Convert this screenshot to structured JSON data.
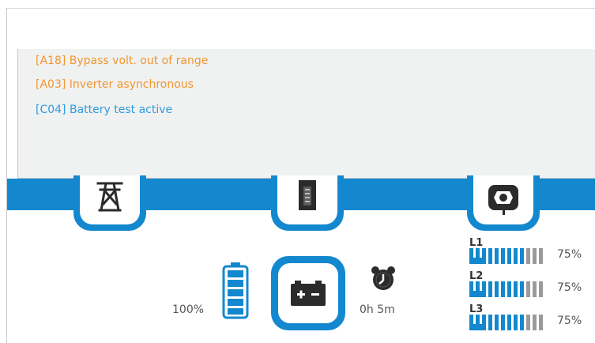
{
  "alarms": [
    {
      "code": "[A18]",
      "text": "Bypass volt. out of range",
      "color": "#f0962f"
    },
    {
      "code": "[A03]",
      "text": "Inverter asynchronous",
      "color": "#f0962f"
    },
    {
      "code": "[C04]",
      "text": "Battery test active",
      "color": "#2f9be0"
    }
  ],
  "colors": {
    "accent": "#1488cf",
    "warning": "#f0962f",
    "info": "#2f9be0"
  },
  "icons": {
    "bypass": "power-tower-icon",
    "inverter": "inverter-icon",
    "output": "power-socket-icon",
    "battery": "battery-icon",
    "battery_level": "battery-level-icon",
    "timer": "alarm-clock-icon"
  },
  "battery": {
    "charge": "100%",
    "charge_value": 1.0,
    "runtime": "0h 5m"
  },
  "loads": [
    {
      "label": "L1",
      "percent": "75%",
      "level": 0.75
    },
    {
      "label": "L2",
      "percent": "75%",
      "level": 0.75
    },
    {
      "label": "L3",
      "percent": "75%",
      "level": 0.75
    }
  ]
}
